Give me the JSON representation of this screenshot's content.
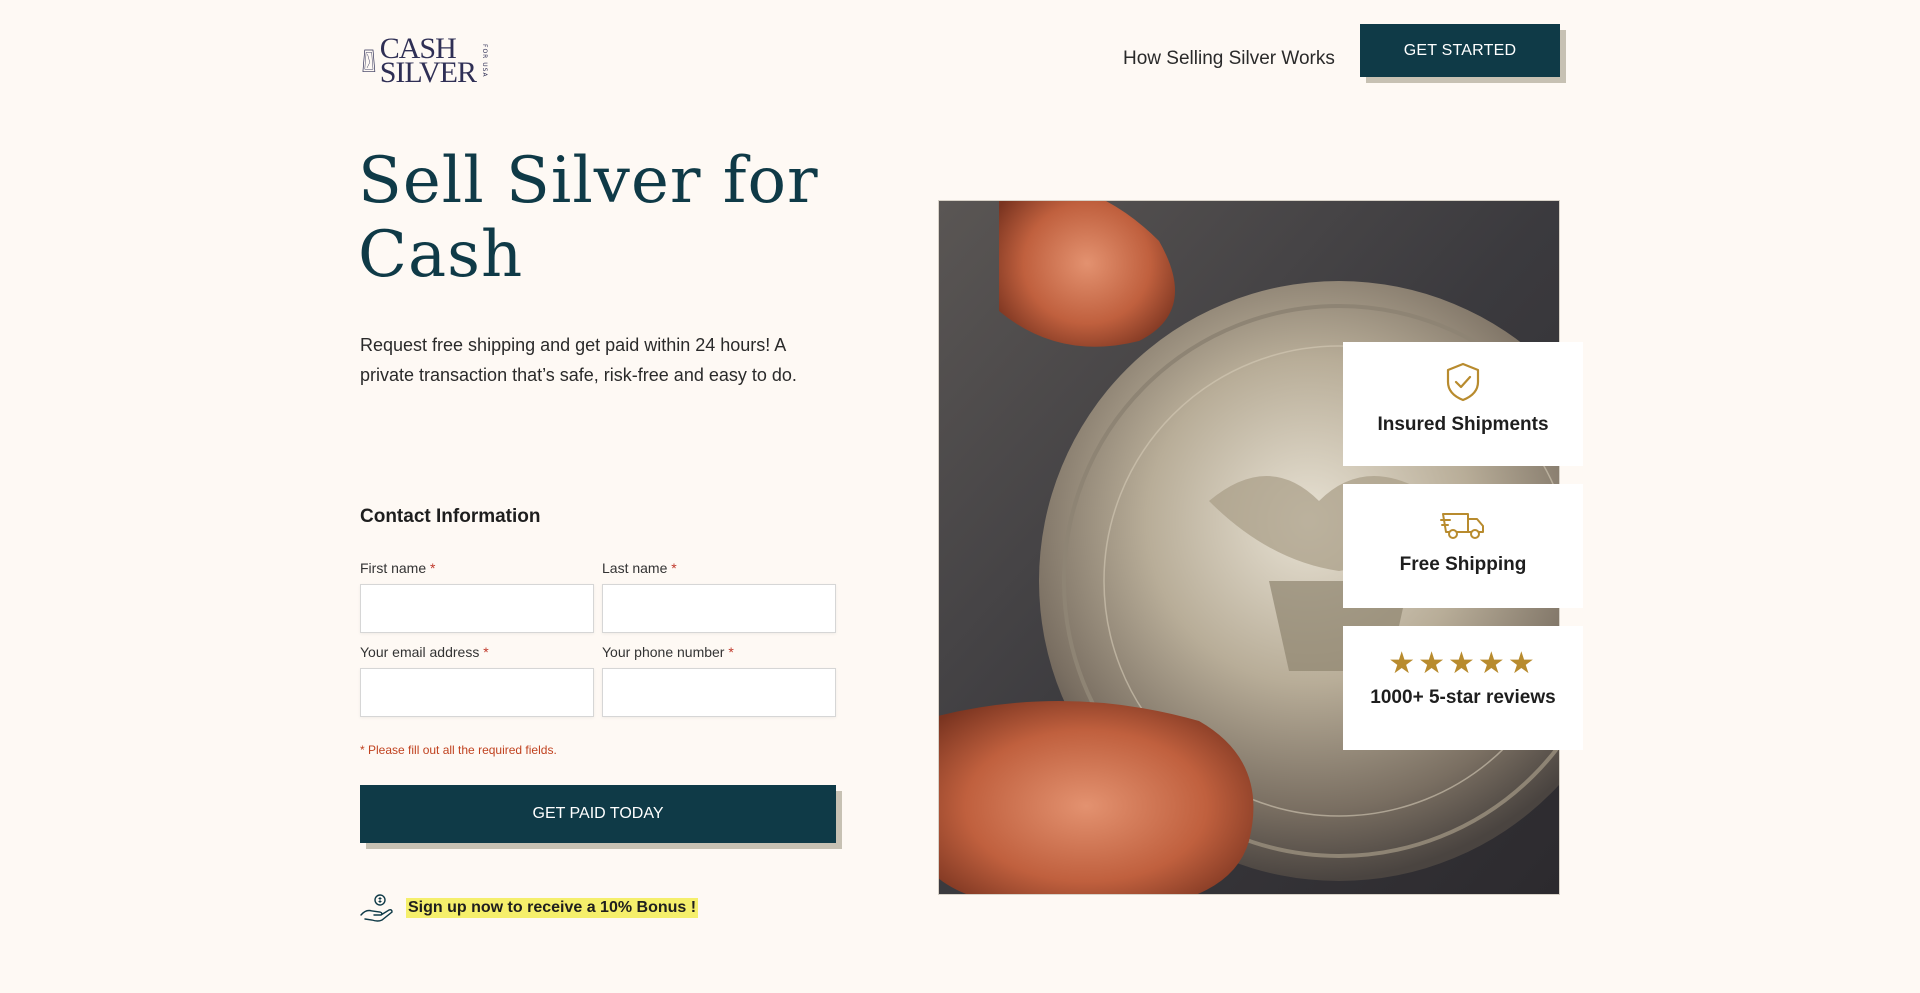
{
  "brand": {
    "logo_line1": "CASH",
    "logo_line2": "SILVER",
    "logo_side": "FOR USA"
  },
  "nav": {
    "how_it_works": "How Selling Silver Works",
    "get_started": "GET STARTED"
  },
  "hero": {
    "title": "Sell Silver for Cash",
    "subtitle": "Request free shipping and get paid within 24 hours! A private transaction that’s safe, risk-free and easy to do."
  },
  "form": {
    "title": "Contact Information",
    "first_name_label": "First name",
    "last_name_label": "Last name",
    "email_label": "Your email address",
    "phone_label": "Your phone number",
    "required_marker": "*",
    "first_name_value": "",
    "last_name_value": "",
    "email_value": "",
    "phone_value": "",
    "error": "* Please fill out all the required fields.",
    "submit": "GET PAID TODAY"
  },
  "bonus": {
    "text": "Sign up now to receive a 10% Bonus !"
  },
  "features": [
    {
      "icon": "shield-check-icon",
      "label": "Insured Shipments"
    },
    {
      "icon": "truck-icon",
      "label": "Free Shipping"
    },
    {
      "icon": "five-stars-icon",
      "label": "1000+ 5-star reviews",
      "stars": "★★★★★"
    }
  ],
  "colors": {
    "background": "#fef9f4",
    "primary": "#0f3a47",
    "accent_gold": "#b88b2e",
    "highlight": "#f5ef6b",
    "error": "#c0421f"
  }
}
